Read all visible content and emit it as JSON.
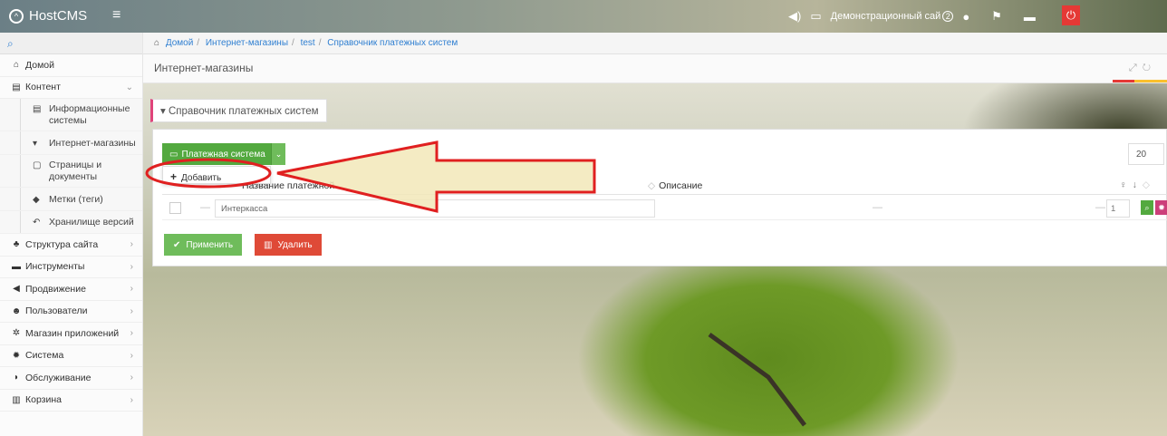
{
  "topbar": {
    "logo": "HostCMS",
    "site_name": "Демонстрационный сай",
    "notification_count": "2"
  },
  "sidebar": {
    "search_icon": "search-icon",
    "items": [
      {
        "label": "Домой",
        "icon": "home-icon"
      },
      {
        "label": "Контент",
        "icon": "content-icon",
        "expanded": true
      },
      {
        "label": "Структура сайта",
        "icon": "sitemap-icon"
      },
      {
        "label": "Инструменты",
        "icon": "tools-icon"
      },
      {
        "label": "Продвижение",
        "icon": "rocket-icon"
      },
      {
        "label": "Пользователи",
        "icon": "users-icon"
      },
      {
        "label": "Магазин приложений",
        "icon": "apps-icon"
      },
      {
        "label": "Система",
        "icon": "gear-icon"
      },
      {
        "label": "Обслуживание",
        "icon": "shield-icon"
      },
      {
        "label": "Корзина",
        "icon": "trash-icon"
      }
    ],
    "subitems": [
      {
        "label": "Информационные системы",
        "icon": "list-icon"
      },
      {
        "label": "Интернет-магазины",
        "icon": "cart-icon"
      },
      {
        "label": "Страницы и документы",
        "icon": "document-icon"
      },
      {
        "label": "Метки (теги)",
        "icon": "tag-icon"
      },
      {
        "label": "Хранилище версий",
        "icon": "history-icon"
      }
    ]
  },
  "breadcrumb": {
    "items": [
      "Домой",
      "Интернет-магазины",
      "test",
      "Справочник платежных систем"
    ]
  },
  "page": {
    "header": "Интернет-магазины",
    "widget_title": "Справочник платежных систем"
  },
  "toolbar": {
    "payment_system_button": "Платежная система",
    "add_label": "Добавить",
    "per_page": "20"
  },
  "table": {
    "col_name": "Название платежной",
    "col_desc": "Описание",
    "rows": [
      {
        "name": "Интеркасса",
        "sort": "1"
      }
    ]
  },
  "actions": {
    "apply": "Применить",
    "delete": "Удалить"
  },
  "colors": {
    "accent_green": "#53a93f",
    "danger_red": "#df4a37",
    "annotation_red": "#e02020",
    "annotation_fill": "#f2e7b8"
  }
}
